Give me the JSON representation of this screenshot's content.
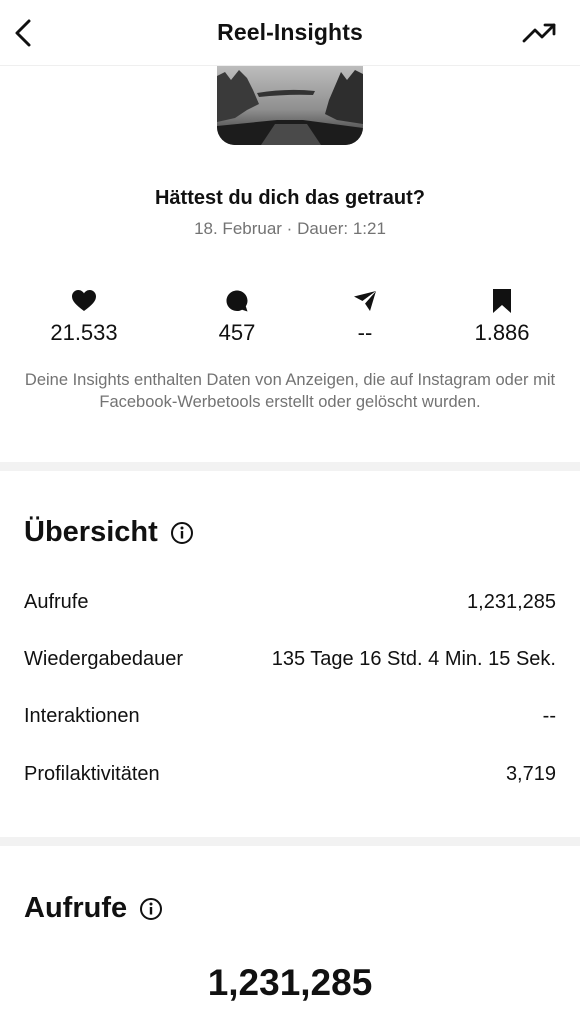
{
  "header": {
    "title": "Reel-Insights",
    "back_icon": "chevron-left-icon",
    "trend_icon": "trending-up-icon"
  },
  "reel": {
    "caption": "Hättest du dich das getraut?",
    "meta": "18. Februar · Dauer: 1:21"
  },
  "stats": [
    {
      "icon": "heart-icon",
      "value": "21.533"
    },
    {
      "icon": "comment-icon",
      "value": "457"
    },
    {
      "icon": "share-icon",
      "value": "--"
    },
    {
      "icon": "bookmark-icon",
      "value": "1.886"
    }
  ],
  "disclaimer": "Deine Insights enthalten Daten von Anzeigen, die auf Instagram oder mit Facebook-Werbetools erstellt oder gelöscht wurden.",
  "overview": {
    "title": "Übersicht",
    "rows": [
      {
        "label": "Aufrufe",
        "value": "1,231,285"
      },
      {
        "label": "Wiedergabedauer",
        "value": "135 Tage 16 Std. 4 Min. 15 Sek."
      },
      {
        "label": "Interaktionen",
        "value": "--"
      },
      {
        "label": "Profilaktivitäten",
        "value": "3,719"
      }
    ]
  },
  "views": {
    "title": "Aufrufe",
    "total": "1,231,285"
  },
  "colors": {
    "text": "#111111",
    "secondary_text": "#737373",
    "separator": "#f2f2f2"
  }
}
